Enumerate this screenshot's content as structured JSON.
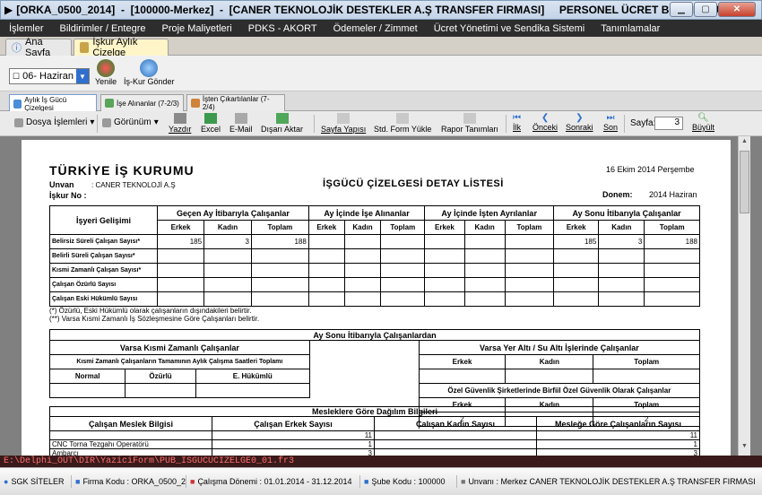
{
  "window": {
    "title": "[ORKA_0500_2014]  -  [100000-Merkez]  -  [CANER TEKNOLOJİK DESTEKLER A.Ş TRANSFER FIRMASI]     PERSONEL ÜCRET BORDROSU"
  },
  "menu": [
    "İşlemler",
    "Bildirimler / Entegre",
    "Proje Maliyetleri",
    "PDKS - AKORT",
    "Ödemeler / Zimmet",
    "Ücret Yönetimi ve Sendika Sistemi",
    "Tanımlamalar"
  ],
  "tabs": [
    "Ana Sayfa",
    "İşkur Aylık Çizelge"
  ],
  "period": {
    "value": "06- Haziran"
  },
  "buttons": {
    "refresh": "Yenile",
    "send": "İş-Kur Gönder"
  },
  "subtabs": [
    "Aylık İş Gücü Çizelgesi",
    "İşe Alınanlar (7-2/3)",
    "İşten Çıkartılanlar (7-2/4)"
  ],
  "toolbar": {
    "file_ops": "Dosya İşlemleri",
    "view": "Görünüm",
    "print": "Yazdır",
    "excel": "Excel",
    "email": "E-Mail",
    "export": "Dışarı Aktar",
    "page_setup": "Sayfa Yapısı",
    "std_form": "Std. Form Yükle",
    "report_defs": "Rapor Tanımları",
    "first": "İlk",
    "prev": "Önceki",
    "next": "Sonraki",
    "last": "Son",
    "page_label": "Sayfa:",
    "page_value": "3",
    "zoom": "Büyült"
  },
  "report": {
    "org": "TÜRKİYE İŞ KURUMU",
    "date": "16 Ekim 2014 Perşembe",
    "unvan_label": "Unvan",
    "unvan_value": ": CANER TEKNOLOJİ A.Ş",
    "iskur_label": "İşkur No :",
    "title": "İŞGÜCÜ ÇİZELGESİ DETAY LİSTESİ",
    "period_label": "Donem:",
    "period_value": "2014 Haziran",
    "col_main": "İşyeri Gelişimi",
    "groups": [
      "Geçen Ay İtibarıyla Çalışanlar",
      "Ay İçinde İşe Alınanlar",
      "Ay İçinde İşten Ayrılanlar",
      "Ay Sonu İtibarıyla Çalışanlar"
    ],
    "sub": [
      "Erkek",
      "Kadın",
      "Toplam"
    ],
    "rows": [
      {
        "label": "Belirsiz Süreli Çalışan Sayısı*",
        "vals": [
          "185",
          "3",
          "188",
          "",
          "",
          "",
          "",
          "",
          "",
          "185",
          "3",
          "188"
        ]
      },
      {
        "label": "Belirli  Süreli Çalışan Sayısı*",
        "vals": [
          "",
          "",
          "",
          "",
          "",
          "",
          "",
          "",
          "",
          "",
          "",
          ""
        ]
      },
      {
        "label": "Kısmi Zamanlı Çalışan Sayısı*",
        "vals": [
          "",
          "",
          "",
          "",
          "",
          "",
          "",
          "",
          "",
          "",
          "",
          ""
        ]
      },
      {
        "label": "Çalışan Özürlü Sayısı",
        "vals": [
          "",
          "",
          "",
          "",
          "",
          "",
          "",
          "",
          "",
          "",
          "",
          ""
        ]
      },
      {
        "label": "Çalışan Eski Hükümlü Sayısı",
        "vals": [
          "",
          "",
          "",
          "",
          "",
          "",
          "",
          "",
          "",
          "",
          "",
          ""
        ]
      }
    ],
    "note1": "(*) Özürlü, Eski Hükümlü olarak çalışanların dışındakileri belirtir.",
    "note2": "(**) Varsa Kısmi Zamanlı İş Sözleşmesine Göre Çalışanları belirtir.",
    "end_title": "Ay Sonu İtibarıyla Çalışanlardan",
    "part_time": "Varsa Kısmi Zamanlı Çalışanlar",
    "part_time_sub": "Kısmi Zamanlı Çalışanların Tamamının Aylık Çalışma Saatleri Toplamı",
    "pt_cols": [
      "Normal",
      "Özürlü",
      "E. Hükümlü"
    ],
    "underground": "Varsa Yer Altı / Su Altı İşlerinde Çalışanlar",
    "ug_cols": [
      "Erkek",
      "Kadın",
      "Toplam"
    ],
    "security": "Özel Güvenlik Şirketlerinde Birfiil Özel Güvenlik Olarak Çalışanlar",
    "sec_vals": [
      "2",
      "",
      "2"
    ],
    "prof_title": "Mesleklere Göre Dağılım Bilgileri",
    "prof_cols": [
      "Çalışan Meslek Bilgisi",
      "Çalışan Erkek Sayısı",
      "Çalışan Kadın Sayısı",
      "Mesleğe Göre Çalışanların Sayısı"
    ],
    "prof_rows": [
      {
        "name": "",
        "m": "11",
        "f": "",
        "t": "11"
      },
      {
        "name": "CNC Torna Tezgahı Operatörü",
        "m": "1",
        "f": "",
        "t": "1"
      },
      {
        "name": "Ambarcı",
        "m": "3",
        "f": "",
        "t": "3"
      }
    ]
  },
  "path": "E:\\Delphi_OUT\\DIR\\YaziciForm\\PUB_ISGUCUCIZELGE0_01.fr3",
  "status": [
    "SGK SİTELER",
    "Firma Kodu : ORKA_0500_2014",
    "Çalışma Dönemi : 01.01.2014 - 31.12.2014",
    "Şube Kodu : 100000",
    "Unvanı : Merkez CANER TEKNOLOJİK DESTEKLER A.Ş TRANSFER FIRMASI"
  ],
  "colors": {
    "menubar": "#2d2d2d",
    "accent": "#2f6fcd",
    "pathbar": "#3a1a1a"
  }
}
